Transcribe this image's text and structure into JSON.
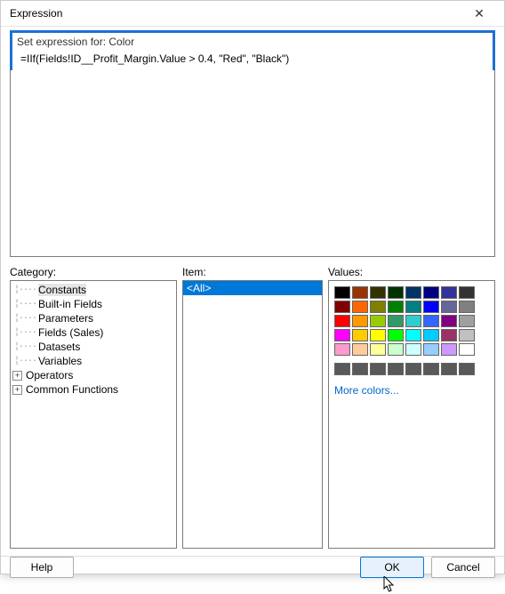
{
  "title": "Expression",
  "set_for_label": "Set expression for: Color",
  "expression_value": "=IIf(Fields!ID__Profit_Margin.Value > 0.4, \"Red\", \"Black\")",
  "panels": {
    "category_label": "Category:",
    "item_label": "Item:",
    "values_label": "Values:"
  },
  "categories": [
    {
      "label": "Constants",
      "expandable": false,
      "selected": true
    },
    {
      "label": "Built-in Fields",
      "expandable": false,
      "selected": false
    },
    {
      "label": "Parameters",
      "expandable": false,
      "selected": false
    },
    {
      "label": "Fields (Sales)",
      "expandable": false,
      "selected": false
    },
    {
      "label": "Datasets",
      "expandable": false,
      "selected": false
    },
    {
      "label": "Variables",
      "expandable": false,
      "selected": false
    },
    {
      "label": "Operators",
      "expandable": true,
      "selected": false
    },
    {
      "label": "Common Functions",
      "expandable": true,
      "selected": false
    }
  ],
  "items": [
    {
      "label": "<All>",
      "selected": true
    }
  ],
  "color_rows": [
    [
      "#000000",
      "#993300",
      "#333300",
      "#003300",
      "#003366",
      "#000080",
      "#333399",
      "#333333"
    ],
    [
      "#800000",
      "#ff6600",
      "#808000",
      "#008000",
      "#008080",
      "#0000ff",
      "#666699",
      "#808080"
    ],
    [
      "#ff0000",
      "#ff9900",
      "#99cc00",
      "#339966",
      "#33cccc",
      "#3366ff",
      "#800080",
      "#a0a0a0"
    ],
    [
      "#ff00ff",
      "#ffcc00",
      "#ffff00",
      "#00ff00",
      "#00ffff",
      "#00ccff",
      "#993366",
      "#c0c0c0"
    ],
    [
      "#ff99cc",
      "#ffcc99",
      "#ffff99",
      "#ccffcc",
      "#ccffff",
      "#99ccff",
      "#cc99ff",
      "#ffffff"
    ]
  ],
  "gray_row": [
    "#595959",
    "#595959",
    "#595959",
    "#595959",
    "#595959",
    "#595959",
    "#595959",
    "#595959"
  ],
  "more_colors_label": "More colors...",
  "buttons": {
    "help": "Help",
    "ok": "OK",
    "cancel": "Cancel"
  }
}
